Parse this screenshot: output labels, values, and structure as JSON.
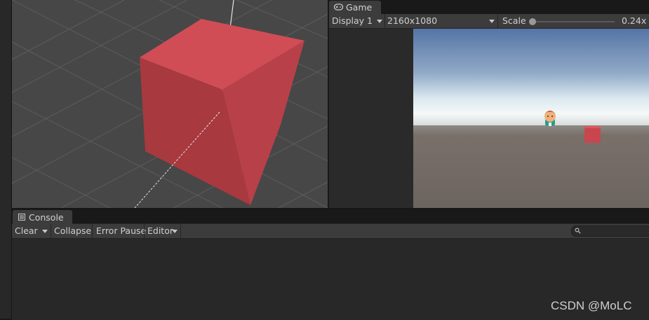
{
  "game": {
    "tab_label": "Game",
    "display_label": "Display 1",
    "resolution_label": "2160x1080",
    "scale_label": "Scale",
    "scale_value": "0.24x",
    "scale_fraction": 0.0
  },
  "console": {
    "tab_label": "Console",
    "clear_label": "Clear",
    "collapse_label": "Collapse",
    "error_pause_label": "Error Pause",
    "editor_label": "Editor",
    "search_value": ""
  },
  "watermark": "CSDN @MoLC",
  "colors": {
    "cube_front": "#a8393f",
    "cube_top": "#d04d56",
    "sky_top": "#5575a6",
    "ground": "#706760",
    "panel_bg": "#282828",
    "toolbar_bg": "#3c3c3c"
  }
}
